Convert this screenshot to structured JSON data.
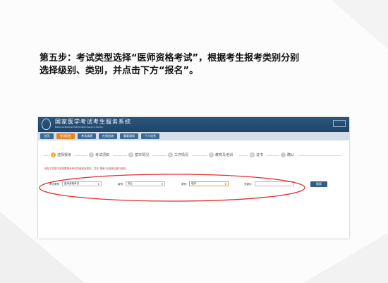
{
  "instruction": {
    "line1": "第五步：考试类型选择“医师资格考试”，根据考生报考类别分别",
    "line2": "选择级别、类别，并点击下方“报名”。"
  },
  "site": {
    "title": "国家医学考试考生服务系统",
    "subtitle": "National Medical Examination Service Centre"
  },
  "nav": {
    "items": [
      "首页",
      "考试报名",
      "考试成绩",
      "在线咨询",
      "重要通知",
      "个人信息"
    ],
    "active_index": 1
  },
  "steps": {
    "items": [
      {
        "num": "1",
        "label": "选择报考"
      },
      {
        "num": "2",
        "label": "考试须知"
      },
      {
        "num": "3",
        "label": "基本情况"
      },
      {
        "num": "4",
        "label": "工作情况"
      },
      {
        "num": "5",
        "label": "教育及培训"
      },
      {
        "num": "6",
        "label": "证书"
      },
      {
        "num": "7",
        "label": "确认"
      }
    ],
    "active_index": 0
  },
  "notice": "请在下拉框中选择要报考考试的级别及类别，并在\"搜索\"后选择后进行选择。",
  "form": {
    "exam_type_label": "考试类型:",
    "exam_type_value": "医师资格考试",
    "level_label": "级别:",
    "level_value": "执业",
    "category_label": "类别:",
    "category_value": "临床",
    "keyword_label": "关键字:",
    "search_button": "搜索"
  },
  "colors": {
    "topbar": "#1f4569",
    "nav_active": "#e0872f",
    "step_active": "#f0a640",
    "annotation_oval": "#e03030",
    "notice_text": "#cc3333"
  }
}
